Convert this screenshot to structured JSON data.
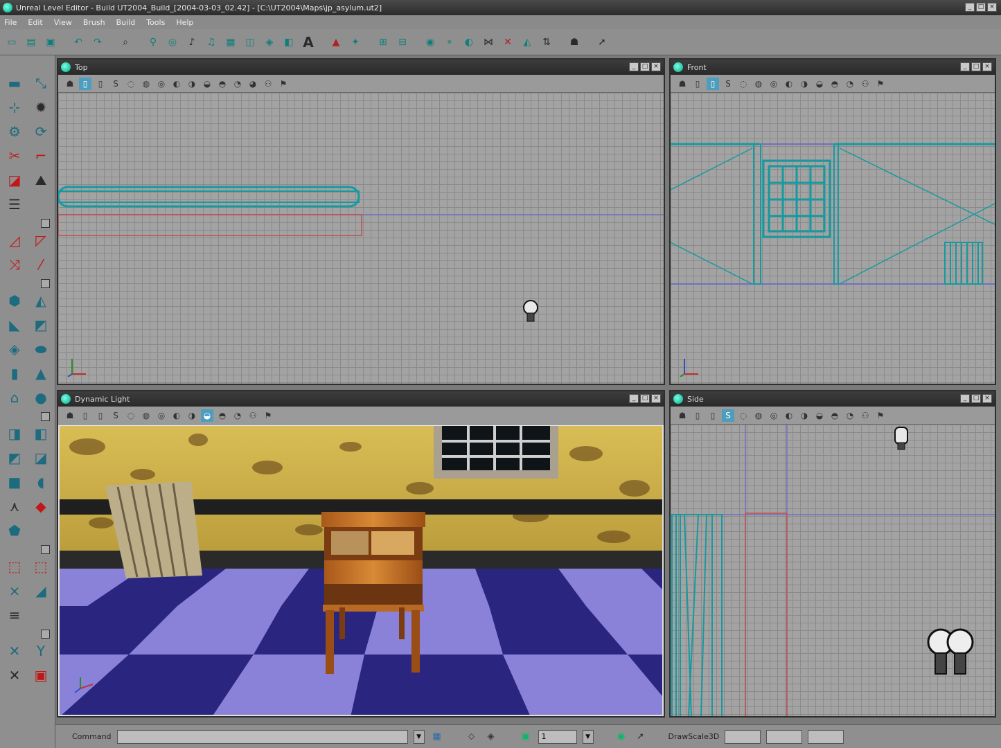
{
  "window": {
    "title": "Unreal Level Editor - Build UT2004_Build_[2004-03-03_02.42] - [C:\\UT2004\\Maps\\jp_asylum.ut2]",
    "buttons": [
      "_",
      "□",
      "×"
    ]
  },
  "menu": [
    "File",
    "Edit",
    "View",
    "Brush",
    "Build",
    "Tools",
    "Help"
  ],
  "viewports": {
    "top": {
      "title": "Top"
    },
    "front": {
      "title": "Front"
    },
    "perspective": {
      "title": "Dynamic Light"
    },
    "side": {
      "title": "Side"
    }
  },
  "statusbar": {
    "command_label": "Command",
    "command_value": "",
    "snap_value": "1",
    "drawscale_label": "DrawScale3D"
  },
  "colors": {
    "grid_bg": "#a3a3a3",
    "grid_line": "#8a8a8a",
    "brush_teal": "#159aa0",
    "builder_red": "#c05050",
    "axis_line": "#7070c0",
    "floor_dark": "#2a2680",
    "floor_light": "#8a82d8",
    "wall": "#c9a94a"
  }
}
